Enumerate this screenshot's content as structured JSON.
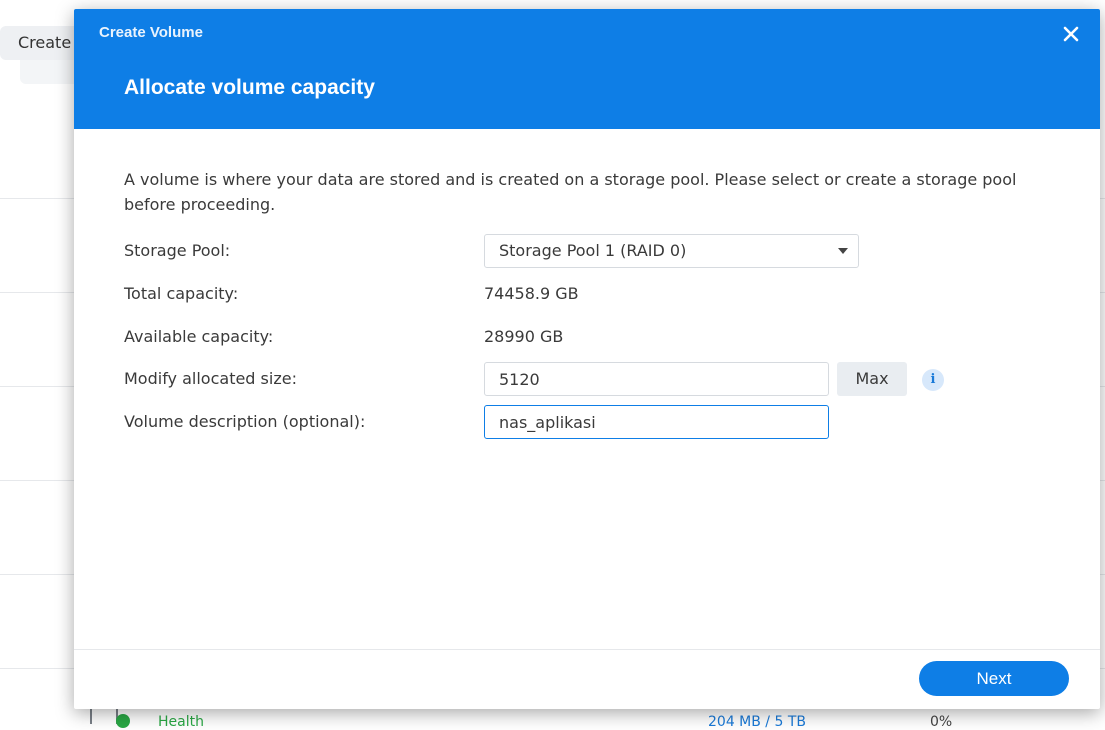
{
  "background": {
    "create_button_label": "Create",
    "bottom_row": {
      "health": "Health",
      "usage": "204 MB / 5 TB",
      "percent": "0%"
    }
  },
  "modal": {
    "title": "Create Volume",
    "heading": "Allocate volume capacity",
    "intro": "A volume is where your data are stored and is created on a storage pool. Please select or create a storage pool before proceeding.",
    "fields": {
      "storage_pool": {
        "label": "Storage Pool:",
        "value": "Storage Pool 1 (RAID 0)"
      },
      "total_capacity": {
        "label": "Total capacity:",
        "value": "74458.9 GB"
      },
      "available_capacity": {
        "label": "Available capacity:",
        "value": "28990 GB"
      },
      "allocated_size": {
        "label": "Modify allocated size:",
        "value": "5120",
        "max_label": "Max"
      },
      "description": {
        "label": "Volume description (optional):",
        "value": "nas_aplikasi"
      }
    },
    "next_label": "Next"
  },
  "icons": {
    "close": "close-icon",
    "dropdown": "chevron-down-icon",
    "info": "info-icon"
  },
  "colors": {
    "accent": "#0e7ee6",
    "info_bg": "#d7e8fb",
    "health_green": "#2aa845"
  }
}
